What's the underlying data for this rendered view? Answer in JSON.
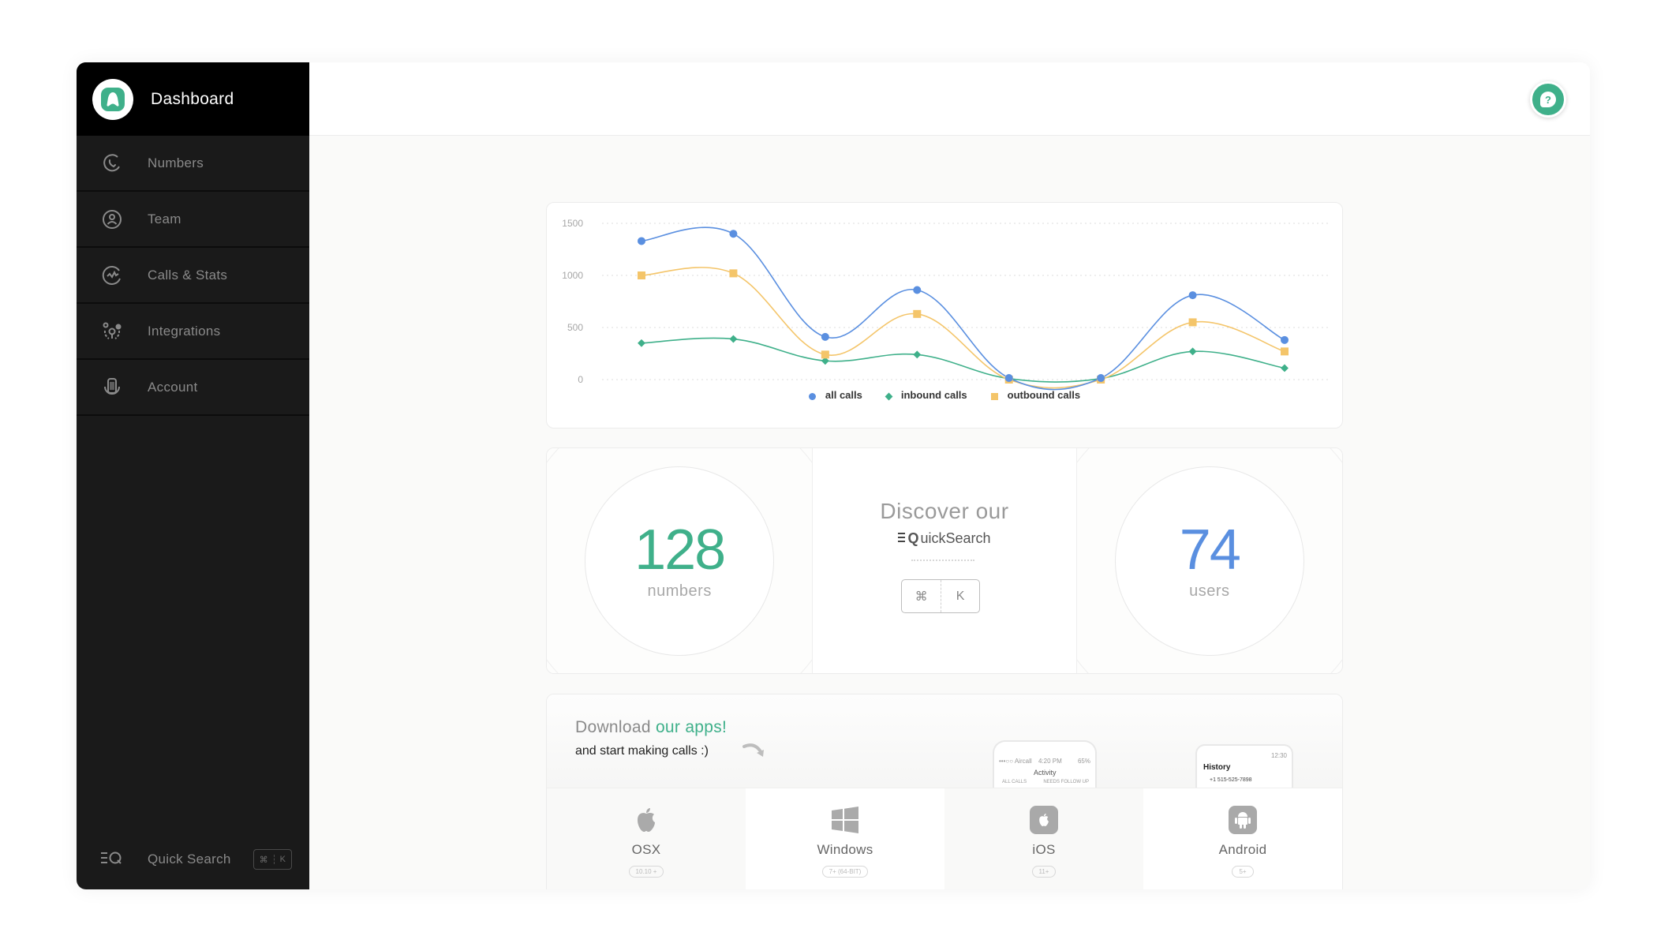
{
  "sidebar": {
    "title": "Dashboard",
    "items": [
      {
        "label": "Numbers",
        "icon": "phone-icon"
      },
      {
        "label": "Team",
        "icon": "user-circle-icon"
      },
      {
        "label": "Calls & Stats",
        "icon": "activity-icon"
      },
      {
        "label": "Integrations",
        "icon": "integrations-icon"
      },
      {
        "label": "Account",
        "icon": "building-icon"
      }
    ],
    "quick_search": {
      "label": "Quick Search",
      "keys": [
        "⌘",
        "K"
      ]
    }
  },
  "topbar": {
    "help_label": "?"
  },
  "colors": {
    "accent": "#3fb08a",
    "all_calls": "#5a8fe0",
    "inbound_calls": "#3fb08a",
    "outbound_calls": "#f4c56a"
  },
  "chart_data": {
    "type": "line",
    "title": "",
    "xlabel": "",
    "ylabel": "",
    "x": [
      1,
      2,
      3,
      4,
      5,
      6,
      7,
      8
    ],
    "ylim": [
      0,
      1500
    ],
    "yticks": [
      "0",
      "500",
      "1000",
      "1500"
    ],
    "grid": true,
    "legend_position": "bottom",
    "series": [
      {
        "name": "all calls",
        "marker": "circle",
        "values": [
          1330,
          1400,
          410,
          860,
          15,
          15,
          810,
          380
        ]
      },
      {
        "name": "inbound calls",
        "marker": "diamond",
        "values": [
          350,
          390,
          180,
          240,
          10,
          10,
          270,
          110
        ]
      },
      {
        "name": "outbound calls",
        "marker": "square",
        "values": [
          1000,
          1020,
          240,
          630,
          0,
          0,
          550,
          270
        ]
      }
    ]
  },
  "stats": {
    "numbers": {
      "value": "128",
      "label": "numbers"
    },
    "users": {
      "value": "74",
      "label": "users"
    }
  },
  "discover": {
    "title": "Discover our",
    "brand_prefix": "Q",
    "brand_rest": "uickSearch",
    "keys": [
      "⌘",
      "K"
    ]
  },
  "download": {
    "title_plain": "Download ",
    "title_accent": "our apps!",
    "subtitle": "and start making calls :)",
    "ios_preview": {
      "carrier": "•••○○ Aircall",
      "time": "4:20 PM",
      "battery": "65%",
      "title": "Activity",
      "tab1": "ALL CALLS",
      "tab2": "NEEDS FOLLOW UP"
    },
    "android_preview": {
      "time": "12:30",
      "title": "History",
      "entry": "+1 515-525-7898"
    },
    "apps": [
      {
        "name": "OSX",
        "version": "10.10 +",
        "icon": "apple-icon"
      },
      {
        "name": "Windows",
        "version": "7+ (64-BIT)",
        "icon": "windows-icon"
      },
      {
        "name": "iOS",
        "version": "11+",
        "icon": "ios-icon"
      },
      {
        "name": "Android",
        "version": "5+",
        "icon": "android-icon"
      }
    ]
  }
}
